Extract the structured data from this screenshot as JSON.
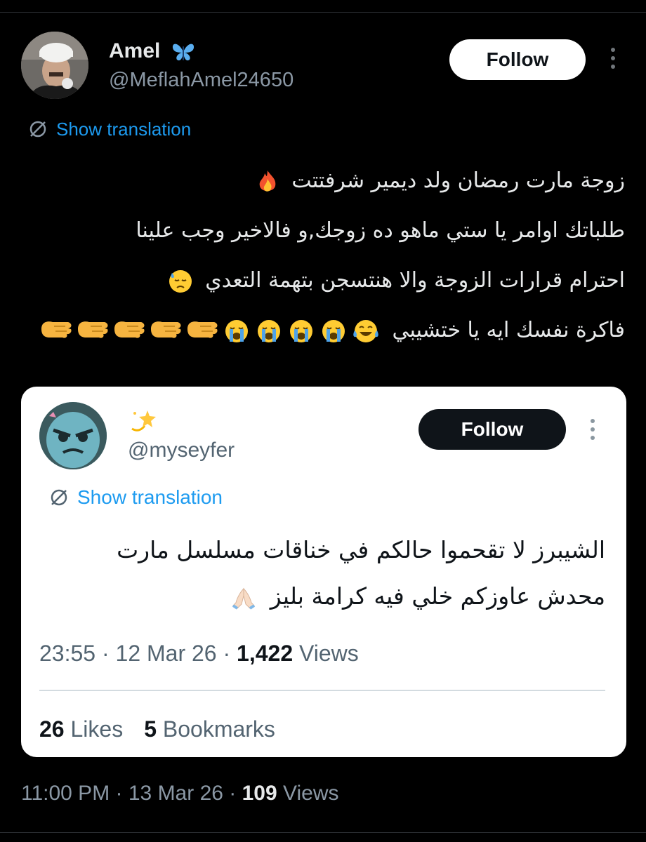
{
  "tweet": {
    "author_name": "Amel",
    "author_handle": "@MeflahAmel24650",
    "follow_label": "Follow",
    "show_translation": "Show translation",
    "text_lines": [
      "زوجة مارت رمضان ولد ديمير شرفتتت",
      "طلباتك اوامر يا ستي ماهو ده زوجك,و فالاخير وجب علينا",
      "احترام قرارات الزوجة والا هنتسجن بتهمة التعدي",
      "فاكرة نفسك ايه يا ختشيبي"
    ],
    "time": "11:00 PM",
    "date": "13 Mar 26",
    "views_count": "109",
    "views_label": "Views"
  },
  "quoted": {
    "author_handle": "@myseyfer",
    "follow_label": "Follow",
    "show_translation": "Show translation",
    "text_lines": [
      "الشيبرز لا تقحموا حالكم في خناقات مسلسل مارت",
      "محدش عاوزكم خلي فيه كرامة بليز"
    ],
    "time": "23:55",
    "date": "12 Mar 26",
    "views_count": "1,422",
    "views_label": "Views",
    "likes_count": "26",
    "likes_label": "Likes",
    "bookmarks_count": "5",
    "bookmarks_label": "Bookmarks"
  },
  "separator": " · ",
  "icons": {
    "name_badge": "butterfly-icon",
    "translate": "translate-slash-icon",
    "more": "more-vertical-icon",
    "quoted_name": "dizzy-star-icon"
  },
  "colors": {
    "background": "#000000",
    "card": "#ffffff",
    "accent_blue": "#1d9bf0",
    "secondary_dark": "#8b98a5",
    "secondary_light": "#536471"
  }
}
